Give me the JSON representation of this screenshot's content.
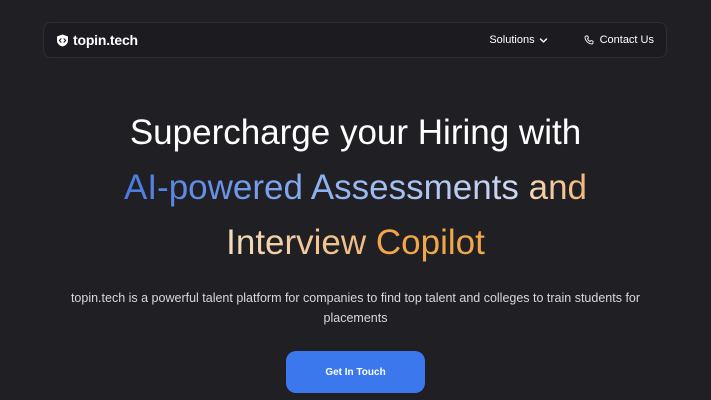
{
  "nav": {
    "brand": "topin.tech",
    "solutions_label": "Solutions",
    "contact_label": "Contact Us"
  },
  "hero": {
    "line1": "Supercharge your Hiring with",
    "line2_part1": "AI-powered Assessments",
    "line2_part2": " and",
    "line3_part1": "Interview ",
    "line3_part2": "Copilot"
  },
  "subtitle": "topin.tech is a powerful talent platform for companies to find top talent and colleges to train students for placements",
  "cta_label": "Get In Touch",
  "colors": {
    "background": "#1f1f24",
    "accent": "#3b78ee",
    "orange": "#f2a64a"
  }
}
